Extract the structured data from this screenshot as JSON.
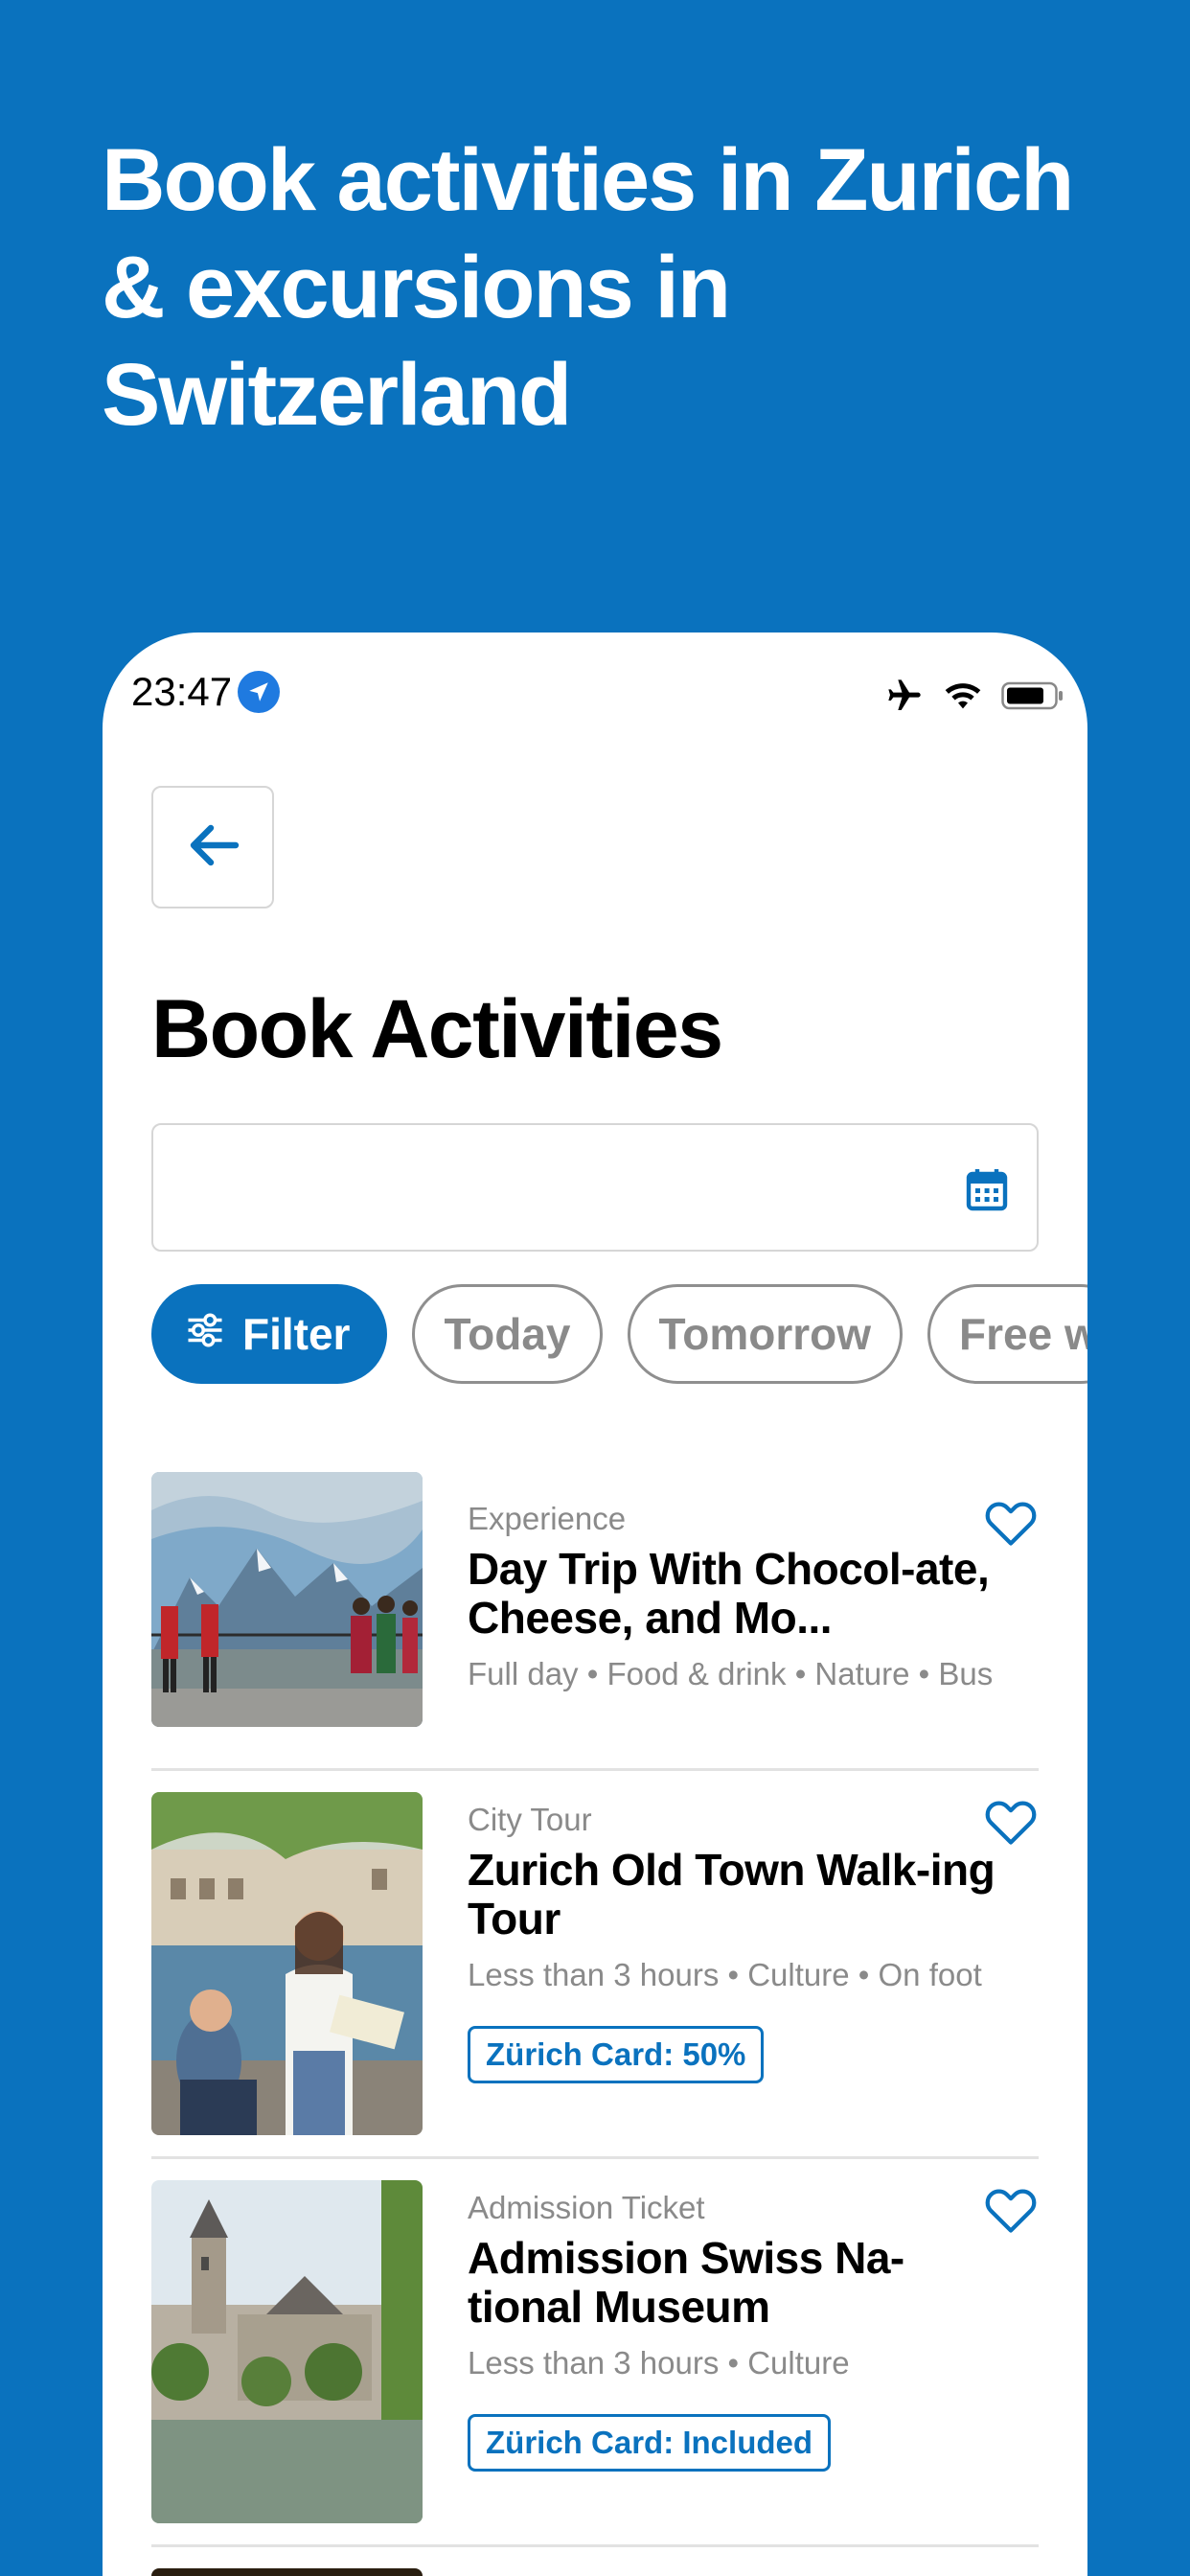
{
  "headline": "Book activities in Zurich & excursions in Switzerland",
  "status_bar": {
    "time": "23:47"
  },
  "page_title": "Book Activities",
  "date_input": {
    "value": "",
    "placeholder": ""
  },
  "chips": [
    {
      "label": "Filter",
      "active": true
    },
    {
      "label": "Today",
      "active": false
    },
    {
      "label": "Tomorrow",
      "active": false
    },
    {
      "label": "Free w",
      "active": false
    }
  ],
  "activities": [
    {
      "category": "Experience",
      "title": "Day Trip With Chocol-ate, Cheese, and Mo...",
      "meta": "Full day • Food & drink • Nature • Bus",
      "badge": ""
    },
    {
      "category": "City Tour",
      "title": "Zurich Old Town Walk-ing Tour",
      "meta": "Less than 3 hours • Culture • On foot",
      "badge": "Zürich Card: 50%"
    },
    {
      "category": "Admission Ticket",
      "title": "Admission Swiss Na-tional Museum",
      "meta": "Less than 3 hours • Culture",
      "badge": "Zürich Card: Included"
    }
  ],
  "colors": {
    "brand": "#0A72BE",
    "muted": "#8a8a8a"
  },
  "icons": [
    "location-arrow-icon",
    "airplane-icon",
    "wifi-icon",
    "battery-icon",
    "back-arrow-icon",
    "calendar-icon",
    "filter-sliders-icon",
    "heart-icon"
  ]
}
